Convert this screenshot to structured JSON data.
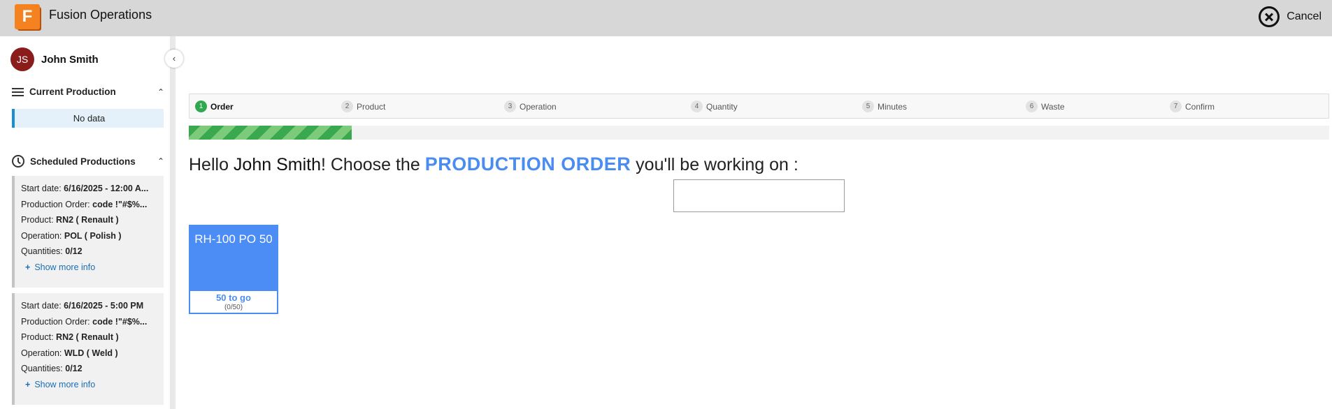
{
  "app": {
    "title": "Fusion Operations",
    "logo_letter": "F",
    "cancel_label": "Cancel"
  },
  "colors": {
    "accent": "#4b8cf5",
    "progress": "#3aa84f",
    "avatar": "#8b1c1c",
    "logo": "#f58220"
  },
  "user": {
    "initials": "JS",
    "name": "John Smith"
  },
  "sidebar": {
    "current_production": {
      "title": "Current Production",
      "empty_text": "No data"
    },
    "scheduled": {
      "title": "Scheduled Productions",
      "items": [
        {
          "start_label": "Start date:",
          "start_value": "6/16/2025 - 12:00 A...",
          "order_label": "Production Order:",
          "order_value": "code !\"#$%...",
          "product_label": "Product:",
          "product_value": "RN2 ( Renault )",
          "operation_label": "Operation:",
          "operation_value": "POL ( Polish )",
          "qty_label": "Quantities:",
          "qty_value": "0/12",
          "more_label": "Show more info"
        },
        {
          "start_label": "Start date:",
          "start_value": "6/16/2025 - 5:00 PM",
          "order_label": "Production Order:",
          "order_value": "code !\"#$%...",
          "product_label": "Product:",
          "product_value": "RN2 ( Renault )",
          "operation_label": "Operation:",
          "operation_value": "WLD ( Weld )",
          "qty_label": "Quantities:",
          "qty_value": "0/12",
          "more_label": "Show more info"
        }
      ]
    }
  },
  "wizard": {
    "steps": [
      {
        "num": "1",
        "label": "Order"
      },
      {
        "num": "2",
        "label": "Product"
      },
      {
        "num": "3",
        "label": "Operation"
      },
      {
        "num": "4",
        "label": "Quantity"
      },
      {
        "num": "5",
        "label": "Minutes"
      },
      {
        "num": "6",
        "label": "Waste"
      },
      {
        "num": "7",
        "label": "Confirm"
      }
    ],
    "active_step": 1,
    "progress_fraction": 0.1429
  },
  "main": {
    "hello": "Hello ",
    "name": "John Smith",
    "choose": "! Choose the ",
    "emphasis": "PRODUCTION ORDER",
    "suffix": " you'll be working on :",
    "search_value": ""
  },
  "orders": [
    {
      "name": "RH-100 PO 50",
      "to_go": "50 to go",
      "ratio": "(0/50)"
    }
  ]
}
